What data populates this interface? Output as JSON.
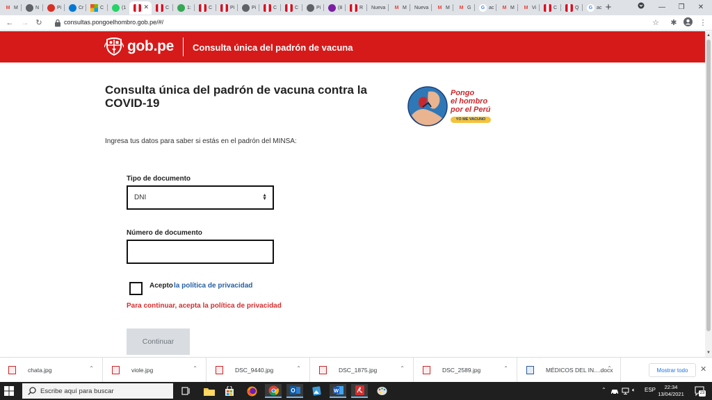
{
  "browser": {
    "tabs": [
      {
        "label": "M",
        "favicon": "gmail-icon",
        "color": "#ea4335"
      },
      {
        "label": "N",
        "favicon": "globe-icon",
        "color": "#5f6368"
      },
      {
        "label": "Pi",
        "favicon": "shield-icon",
        "color": "#d93025"
      },
      {
        "label": "Cr",
        "favicon": "outlook-icon",
        "color": "#0078d4"
      },
      {
        "label": "C",
        "favicon": "microsoft-icon",
        "color": "#f25022"
      },
      {
        "label": "(1",
        "favicon": "whatsapp-icon",
        "color": "#25d366"
      },
      {
        "label": "",
        "favicon": "peru-flag-icon",
        "color": "#d91023",
        "active": true
      },
      {
        "label": "C",
        "favicon": "peru-flag-icon",
        "color": "#d91023"
      },
      {
        "label": "1:",
        "favicon": "maps-pin-icon",
        "color": "#34a853"
      },
      {
        "label": "C",
        "favicon": "peru-flag-icon",
        "color": "#d91023"
      },
      {
        "label": "Pi",
        "favicon": "peru-flag-icon",
        "color": "#d91023"
      },
      {
        "label": "Pi",
        "favicon": "globe-icon",
        "color": "#5f6368"
      },
      {
        "label": "C",
        "favicon": "peru-flag-icon",
        "color": "#d91023"
      },
      {
        "label": "C",
        "favicon": "peru-flag-icon",
        "color": "#d91023"
      },
      {
        "label": "Pi",
        "favicon": "globe-icon",
        "color": "#5f6368"
      },
      {
        "label": "(8",
        "favicon": "mail-icon",
        "color": "#7b1fa2"
      },
      {
        "label": "R",
        "favicon": "peru-flag-icon",
        "color": "#d91023"
      },
      {
        "label": "Nueva",
        "favicon": "",
        "color": ""
      },
      {
        "label": "M",
        "favicon": "gmail-icon",
        "color": "#ea4335"
      },
      {
        "label": "Nueva",
        "favicon": "",
        "color": ""
      },
      {
        "label": "M",
        "favicon": "gmail-icon",
        "color": "#ea4335"
      },
      {
        "label": "G",
        "favicon": "gmail-icon",
        "color": "#ea4335"
      },
      {
        "label": "ac",
        "favicon": "google-icon",
        "color": "#4285f4"
      },
      {
        "label": "M",
        "favicon": "gmail-icon",
        "color": "#ea4335"
      },
      {
        "label": "Vi",
        "favicon": "gmail-icon",
        "color": "#ea4335"
      },
      {
        "label": "C",
        "favicon": "peru-flag-icon",
        "color": "#d91023"
      },
      {
        "label": "Q",
        "favicon": "peru-flag-icon",
        "color": "#d91023"
      },
      {
        "label": "ac",
        "favicon": "google-icon",
        "color": "#4285f4"
      }
    ],
    "url": "consultas.pongoelhombro.gob.pe/#/"
  },
  "site": {
    "logo_text": "gob.pe",
    "header_title": "Consulta única del padrón de vacuna",
    "brand_color": "#d61a1a"
  },
  "page": {
    "title": "Consulta única del padrón de vacuna contra la COVID-19",
    "campaign": {
      "line1": "Pongo",
      "line2": "el hombro",
      "line3": "por el Perú",
      "pill": "YO ME VACUNO"
    },
    "intro": "Ingresa tus datos para saber si estás en el padrón del MINSA:",
    "doc_type_label": "Tipo de documento",
    "doc_type_value": "DNI",
    "doc_number_label": "Número de documento",
    "doc_number_value": "",
    "accept_label": "Acepto",
    "policy_link": "la política de privacidad",
    "error": "Para continuar, acepta la política de privacidad",
    "continue_button": "Continuar"
  },
  "downloads": {
    "items": [
      {
        "name": "chata.jpg",
        "type": "image"
      },
      {
        "name": "viole.jpg",
        "type": "image"
      },
      {
        "name": "DSC_9440.jpg",
        "type": "image"
      },
      {
        "name": "DSC_1875.jpg",
        "type": "image"
      },
      {
        "name": "DSC_2589.jpg",
        "type": "image"
      },
      {
        "name": "MÉDICOS DEL IN....docx",
        "type": "doc"
      }
    ],
    "show_all": "Mostrar todo"
  },
  "taskbar": {
    "search_placeholder": "Escribe aquí para buscar",
    "language": "ESP",
    "time": "22:34",
    "date": "13/04/2021",
    "notifications": "23"
  }
}
